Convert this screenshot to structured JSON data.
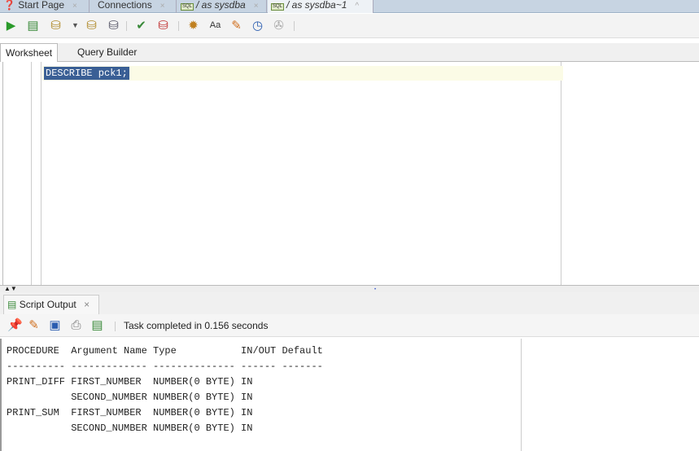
{
  "doc_tabs": [
    {
      "label": "Start Page"
    },
    {
      "label": "Connections"
    },
    {
      "label": "/ as sysdba"
    },
    {
      "label": "/ as sysdba~1"
    }
  ],
  "sql_badge": "SQL",
  "worksheet_tabs": [
    {
      "label": "Worksheet"
    },
    {
      "label": "Query Builder"
    }
  ],
  "editor": {
    "code": "DESCRIBE pck1;"
  },
  "output": {
    "tab_label": "Script Output",
    "close": "×",
    "status": "Task completed in 0.156 seconds",
    "text": "PROCEDURE  Argument Name Type           IN/OUT Default\n---------- ------------- -------------- ------ -------\nPRINT_DIFF FIRST_NUMBER  NUMBER(0 BYTE) IN\n           SECOND_NUMBER NUMBER(0 BYTE) IN\nPRINT_SUM  FIRST_NUMBER  NUMBER(0 BYTE) IN\n           SECOND_NUMBER NUMBER(0 BYTE) IN"
  }
}
